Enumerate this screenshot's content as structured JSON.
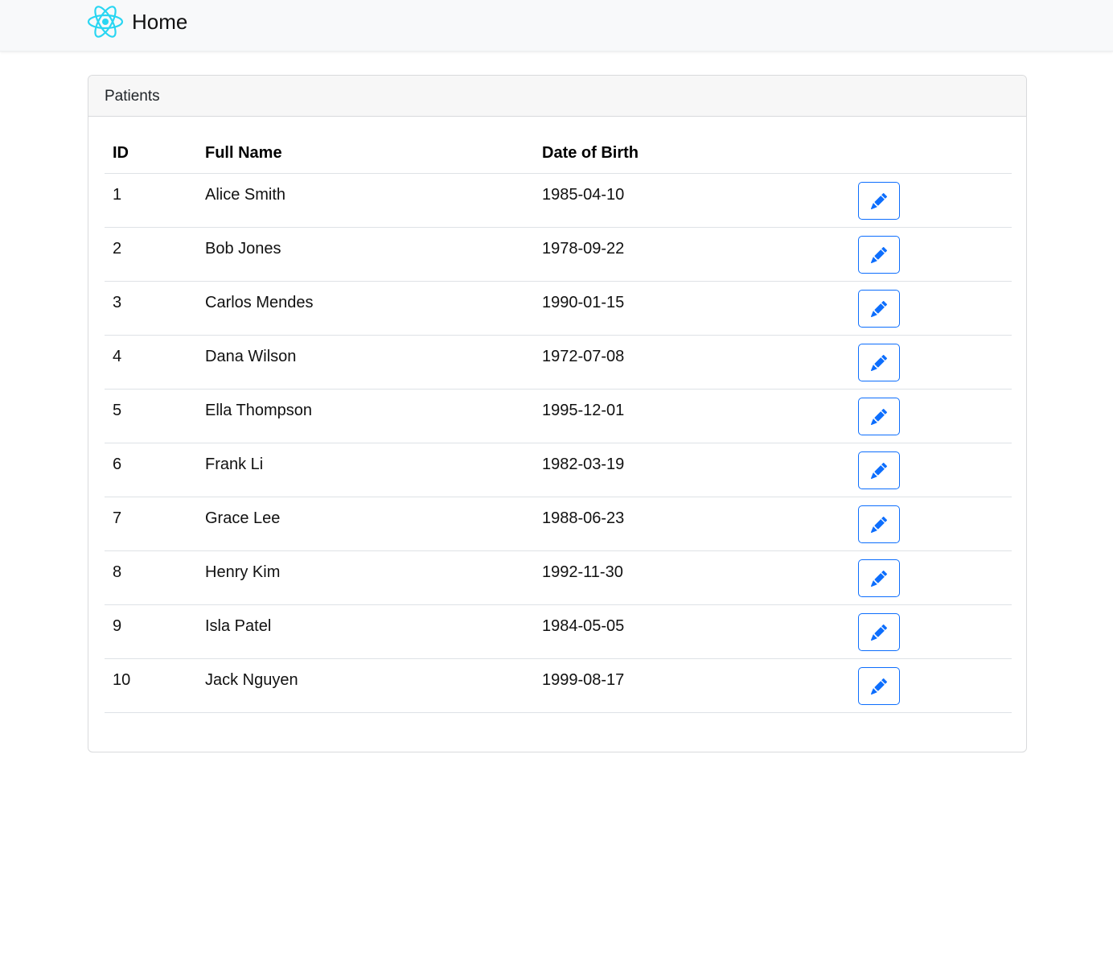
{
  "navbar": {
    "brand_label": "Home",
    "logo_icon": "react-logo-icon",
    "logo_color": "#61dafb"
  },
  "card": {
    "title": "Patients"
  },
  "table": {
    "columns": [
      "ID",
      "Full Name",
      "Date of Birth",
      ""
    ],
    "rows": [
      {
        "id": "1",
        "name": "Alice Smith",
        "dob": "1985-04-10"
      },
      {
        "id": "2",
        "name": "Bob Jones",
        "dob": "1978-09-22"
      },
      {
        "id": "3",
        "name": "Carlos Mendes",
        "dob": "1990-01-15"
      },
      {
        "id": "4",
        "name": "Dana Wilson",
        "dob": "1972-07-08"
      },
      {
        "id": "5",
        "name": "Ella Thompson",
        "dob": "1995-12-01"
      },
      {
        "id": "6",
        "name": "Frank Li",
        "dob": "1982-03-19"
      },
      {
        "id": "7",
        "name": "Grace Lee",
        "dob": "1988-06-23"
      },
      {
        "id": "8",
        "name": "Henry Kim",
        "dob": "1992-11-30"
      },
      {
        "id": "9",
        "name": "Isla Patel",
        "dob": "1984-05-05"
      },
      {
        "id": "10",
        "name": "Jack Nguyen",
        "dob": "1999-08-17"
      }
    ],
    "row_action_icon": "pencil-icon",
    "accent_color": "#0d6efd"
  }
}
